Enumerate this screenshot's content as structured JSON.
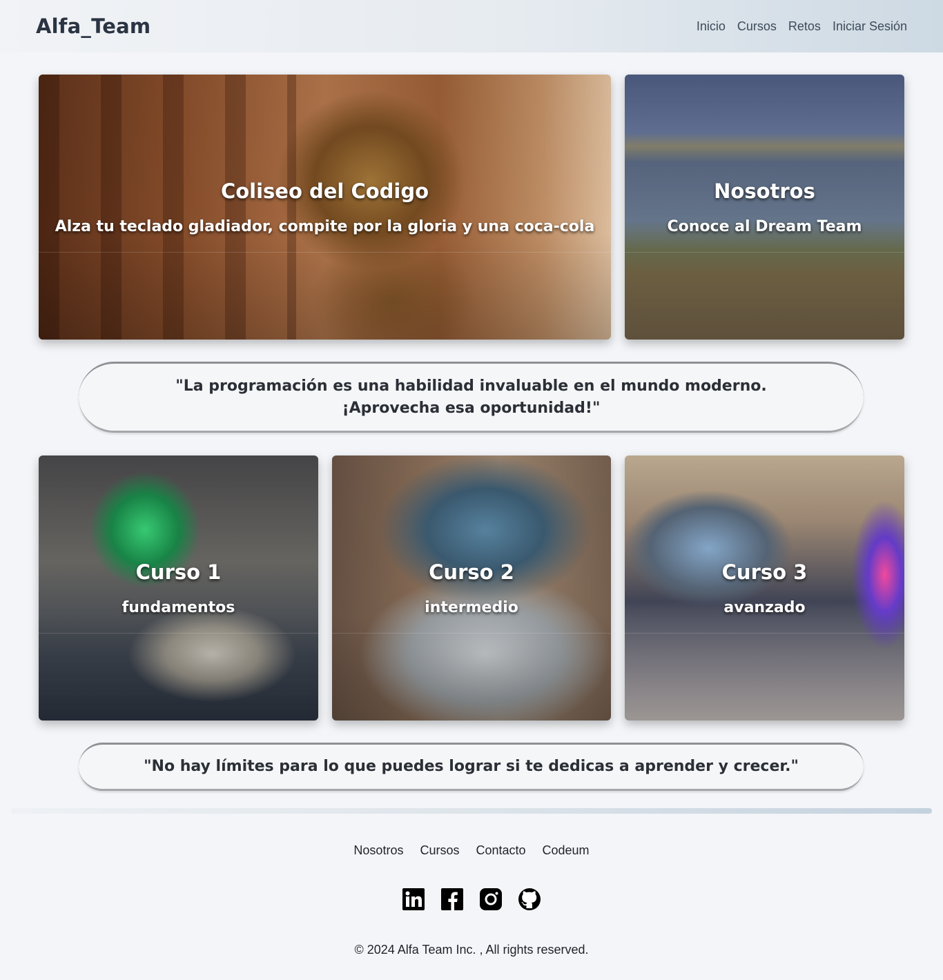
{
  "header": {
    "brand": "Alfa_Team",
    "nav": [
      "Inicio",
      "Cursos",
      "Retos",
      "Iniciar Sesión"
    ]
  },
  "hero": {
    "coliseo": {
      "title": "Coliseo del Codigo",
      "subtitle": "Alza tu teclado gladiador, compite por la gloria y una coca-cola"
    },
    "nosotros": {
      "title": "Nosotros",
      "subtitle": "Conoce al Dream Team"
    }
  },
  "quotes": [
    "\"La programación es una habilidad invaluable en el mundo moderno. ¡Aprovecha esa oportunidad!\"",
    "\"No hay límites para lo que puedes lograr si te dedicas a aprender y crecer.\""
  ],
  "courses": [
    {
      "title": "Curso 1",
      "level": "fundamentos"
    },
    {
      "title": "Curso 2",
      "level": "intermedio"
    },
    {
      "title": "Curso 3",
      "level": "avanzado"
    }
  ],
  "footer": {
    "links": [
      "Nosotros",
      "Cursos",
      "Contacto",
      "Codeum"
    ],
    "socials": [
      "linkedin-icon",
      "facebook-icon",
      "instagram-icon",
      "github-icon"
    ],
    "copyright": "© 2024 Alfa Team Inc. , All rights reserved."
  }
}
